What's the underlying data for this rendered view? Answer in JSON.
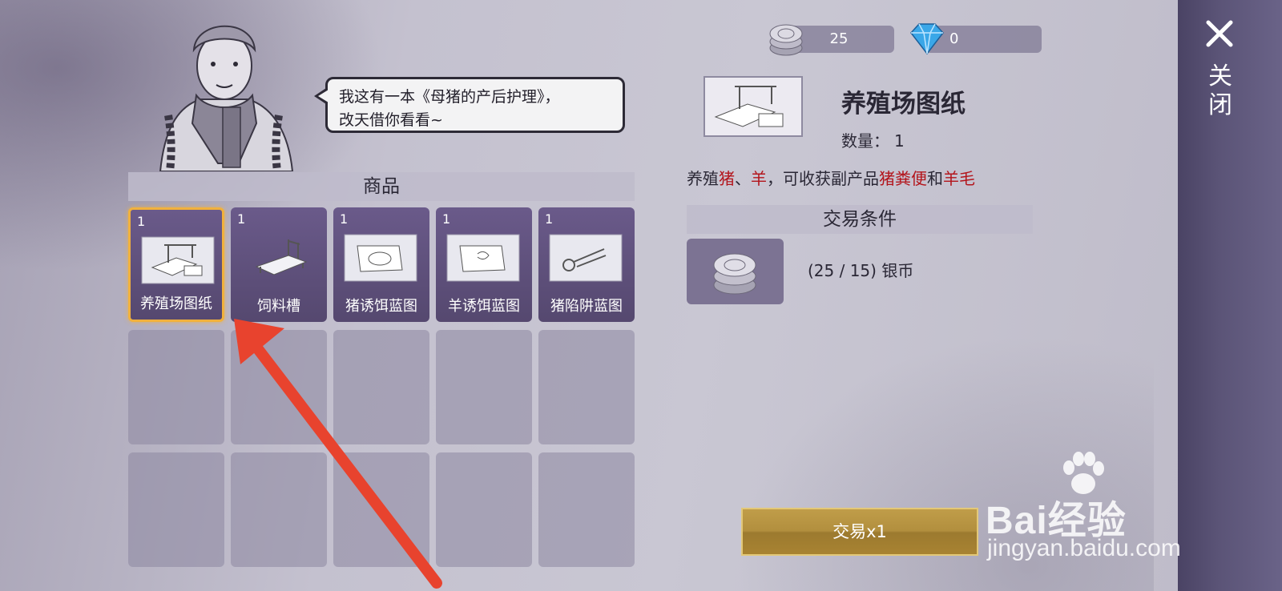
{
  "npc": {
    "speech": [
      "我这有一本《母猪的产后护理》，",
      "改天借你看看~"
    ]
  },
  "goods": {
    "header": "商品",
    "items": [
      {
        "qty": "1",
        "label": "养殖场图纸",
        "selected": true
      },
      {
        "qty": "1",
        "label": "饲料槽"
      },
      {
        "qty": "1",
        "label": "猪诱饵蓝图"
      },
      {
        "qty": "1",
        "label": "羊诱饵蓝图"
      },
      {
        "qty": "1",
        "label": "猪陷阱蓝图"
      }
    ],
    "empty_slots": 10
  },
  "currency": {
    "silver": "25",
    "gems": "0"
  },
  "detail": {
    "title": "养殖场图纸",
    "qty_label": "数量：",
    "qty_value": "1",
    "desc": {
      "p1": "养殖",
      "r1": "猪",
      "p2": "、",
      "r2": "羊",
      "p3": "，可收获副产品",
      "r3": "猪粪便",
      "p4": "和",
      "r4": "羊毛"
    },
    "cond_header": "交易条件",
    "cond_text": "(25 / 15) 银币",
    "trade_button": "交易x1"
  },
  "close": {
    "label": "关闭"
  },
  "watermark": {
    "brand": "Bai经验",
    "url": "jingyan.baidu.com"
  },
  "colors": {
    "accent_gold": "#f1b13d",
    "highlight_red": "#b3141b",
    "slot_purple": "#5f507c"
  }
}
